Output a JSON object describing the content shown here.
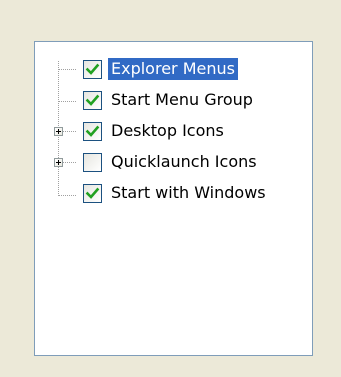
{
  "tree": {
    "items": [
      {
        "label": "Explorer Menus",
        "checked": true,
        "selected": true,
        "expandable": false
      },
      {
        "label": "Start Menu Group",
        "checked": true,
        "selected": false,
        "expandable": false
      },
      {
        "label": "Desktop Icons",
        "checked": true,
        "selected": false,
        "expandable": true
      },
      {
        "label": "Quicklaunch Icons",
        "checked": false,
        "selected": false,
        "expandable": true
      },
      {
        "label": "Start with Windows",
        "checked": true,
        "selected": false,
        "expandable": false
      }
    ]
  },
  "colors": {
    "window_background": "#ECE9D8",
    "panel_border": "#7F9DB9",
    "checkbox_border": "#1C5180",
    "check_mark": "#21A121",
    "selection_background": "#316AC5"
  },
  "icons": {
    "checked": "checkmark-icon",
    "expand": "plus-icon"
  }
}
